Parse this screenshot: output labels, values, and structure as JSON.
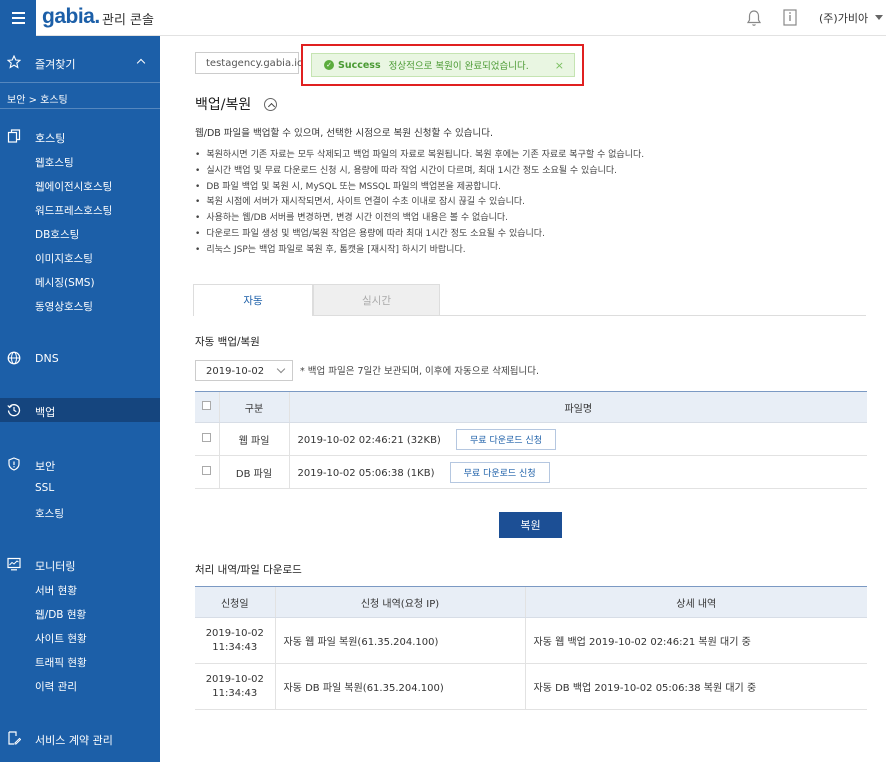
{
  "header": {
    "logo": "gabia.",
    "title": "관리 콘솔",
    "user": "(주)가비아"
  },
  "sidebar": {
    "favorites": "즐겨찾기",
    "breadcrumb": "보안 > 호스팅",
    "groups": [
      {
        "label": "호스팅",
        "icon": "copy-icon",
        "items": [
          "웹호스팅",
          "웹에이전시호스팅",
          "워드프레스호스팅",
          "DB호스팅",
          "이미지호스팅",
          "메시징(SMS)",
          "동영상호스팅"
        ]
      },
      {
        "label": "DNS",
        "icon": "globe-icon",
        "items": []
      },
      {
        "label": "백업",
        "icon": "history-icon",
        "items": []
      },
      {
        "label": "보안",
        "icon": "shield-icon",
        "items": [
          "SSL",
          "호스팅"
        ]
      },
      {
        "label": "모니터링",
        "icon": "monitor-icon",
        "items": [
          "서버 현황",
          "웹/DB 현황",
          "사이트 현황",
          "트래픽 현황",
          "이력 관리"
        ]
      },
      {
        "label": "서비스 계약 관리",
        "icon": "contract-icon",
        "items": []
      }
    ]
  },
  "main": {
    "domain": "testagency.gabia.io",
    "alert": {
      "strong": "Success",
      "message": "정상적으로 복원이 완료되었습니다.",
      "close": "×"
    },
    "title": "백업/복원",
    "description": "웹/DB 파일을 백업할 수 있으며, 선택한 시점으로 복원 신청할 수 있습니다.",
    "bullets": [
      "복원하시면 기존 자료는 모두 삭제되고 백업 파일의 자료로 복원됩니다. 복원 후에는 기존 자료로 복구할 수 없습니다.",
      "실시간 백업 및 무료 다운로드 신청 시, 용량에 따라 작업 시간이 다르며, 최대 1시간 정도 소요될 수 있습니다.",
      "DB 파일 백업 및 복원 시, MySQL 또는 MSSQL 파일의 백업본을 제공합니다.",
      "복원 시점에 서버가 재시작되면서, 사이트 연결이 수초 이내로 잠시 끊길 수 있습니다.",
      "사용하는 웹/DB 서버를 변경하면, 변경 시간 이전의 백업 내용은 볼 수 없습니다.",
      "다운로드 파일 생성 및 백업/복원 작업은 용량에 따라 최대 1시간 정도 소요될 수 있습니다.",
      "리눅스 JSP는 백업 파일로 복원 후, 톰캣을 [재시작] 하시기 바랍니다."
    ],
    "tabs": [
      "자동",
      "실시간"
    ],
    "auto_section_title": "자동 백업/복원",
    "date_value": "2019-10-02",
    "date_note": "* 백업 파일은 7일간 보관되며, 이후에 자동으로 삭제됩니다.",
    "backup_table": {
      "headers": [
        "구분",
        "파일명"
      ],
      "rows": [
        {
          "type": "웹 파일",
          "file": "2019-10-02 02:46:21 (32KB)",
          "button": "무료 다운로드 신청"
        },
        {
          "type": "DB 파일",
          "file": "2019-10-02 05:06:38 (1KB)",
          "button": "무료 다운로드 신청"
        }
      ]
    },
    "restore_button": "복원",
    "history_section_title": "처리 내역/파일 다운로드",
    "history_table": {
      "headers": [
        "신청일",
        "신청 내역(요청 IP)",
        "상세 내역"
      ],
      "rows": [
        {
          "date": "2019-10-02",
          "time": "11:34:43",
          "request": "자동 웹 파일 복원(61.35.204.100)",
          "detail": "자동 웹 백업 2019-10-02 02:46:21 복원 대기 중"
        },
        {
          "date": "2019-10-02",
          "time": "11:34:43",
          "request": "자동 DB 파일 복원(61.35.204.100)",
          "detail": "자동 DB 백업 2019-10-02 05:06:38 복원 대기 중"
        }
      ]
    }
  },
  "colors": {
    "brand": "#1c5fa8",
    "brand_dark": "#15457e",
    "success_bg": "#e9f6e2",
    "success_text": "#4a9a33",
    "highlight": "#e02020"
  }
}
